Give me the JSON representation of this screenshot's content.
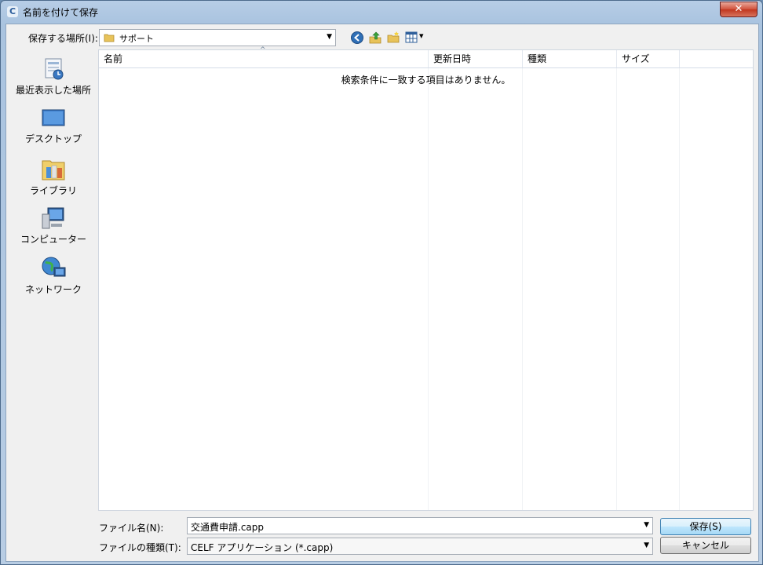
{
  "window": {
    "title": "名前を付けて保存",
    "close_label": "✕",
    "app_icon_letter": "C"
  },
  "toolbar": {
    "savein_label": "保存する場所(I):",
    "savein_value": "サポート",
    "view_arrow": "▾"
  },
  "places": [
    {
      "label": "最近表示した場所",
      "icon": "recent-places-icon"
    },
    {
      "label": "デスクトップ",
      "icon": "desktop-icon"
    },
    {
      "label": "ライブラリ",
      "icon": "libraries-icon"
    },
    {
      "label": "コンピューター",
      "icon": "computer-icon"
    },
    {
      "label": "ネットワーク",
      "icon": "network-icon"
    }
  ],
  "filelist": {
    "columns": [
      "名前",
      "更新日時",
      "種類",
      "サイズ"
    ],
    "sort_indicator": "^",
    "empty_message": "検索条件に一致する項目はありません。"
  },
  "bottom": {
    "filename_label": "ファイル名(N):",
    "filename_value": "交通費申請.capp",
    "filetype_label": "ファイルの種類(T):",
    "filetype_value": "CELF アプリケーション (*.capp)",
    "save_button": "保存(S)",
    "cancel_button": "キャンセル",
    "dropdown_arrow": "▼"
  },
  "colors": {
    "title_bar": "#b7cde6",
    "close_button": "#c0361e",
    "accent": "#3c7fb1"
  }
}
